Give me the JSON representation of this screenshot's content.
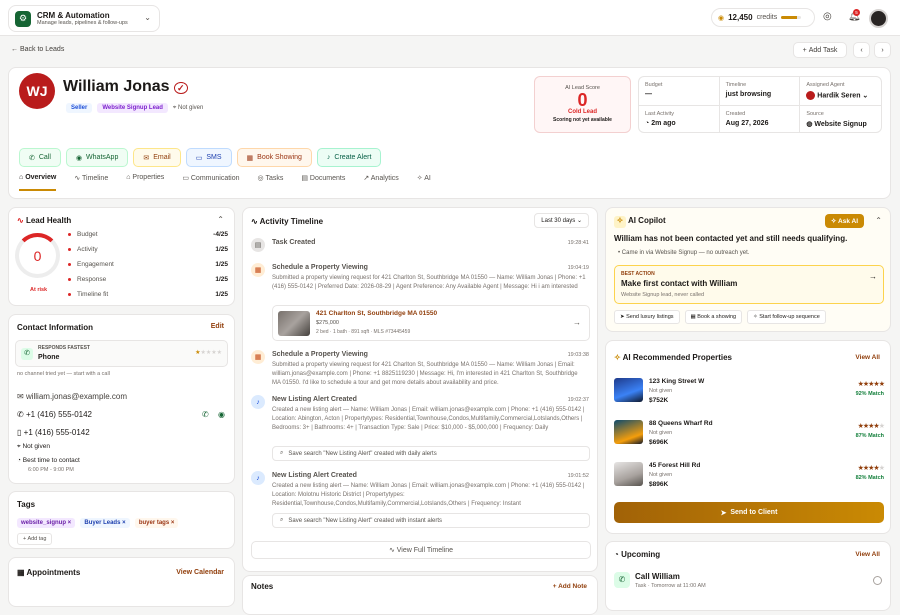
{
  "topbar": {
    "app_title": "CRM & Automation",
    "app_subtitle": "Manage leads, pipelines & follow-ups",
    "credits_value": "12,450",
    "credits_label": "credits",
    "credits_fraction": 0.8,
    "notif_count": "5"
  },
  "nav": {
    "back_label": "Back to Leads",
    "add_task_label": "Add Task"
  },
  "lead": {
    "initials": "WJ",
    "name": "William Jonas",
    "tag_seller": "Seller",
    "tag_source": "Website Signup Lead",
    "not_given": "Not given"
  },
  "score": {
    "label": "AI Lead Score",
    "value": "0",
    "category": "Cold Lead",
    "note": "Scoring not yet available"
  },
  "info": [
    {
      "key": "Budget",
      "value": "—"
    },
    {
      "key": "Timeline",
      "value": "just browsing"
    },
    {
      "key": "Assigned Agent",
      "value": "Hardik Seren"
    },
    {
      "key": "Last Activity",
      "value": "2m ago"
    },
    {
      "key": "Created",
      "value": "Aug 27, 2026"
    },
    {
      "key": "Source",
      "value": "Website Signup"
    }
  ],
  "actions": [
    "Call",
    "WhatsApp",
    "Email",
    "SMS",
    "Book Showing",
    "Create Alert"
  ],
  "tabs": [
    "Overview",
    "Timeline",
    "Properties",
    "Communication",
    "Tasks",
    "Documents",
    "Analytics",
    "AI"
  ],
  "health": {
    "title": "Lead Health",
    "score": "0",
    "risk": "At risk",
    "rows": [
      {
        "label": "Budget",
        "value": "-4/25"
      },
      {
        "label": "Activity",
        "value": "1/25"
      },
      {
        "label": "Engagement",
        "value": "1/25"
      },
      {
        "label": "Response",
        "value": "1/25"
      },
      {
        "label": "Timeline fit",
        "value": "1/25"
      }
    ]
  },
  "contact": {
    "title": "Contact Information",
    "edit": "Edit",
    "responds_label": "RESPONDS FASTEST",
    "channel": "Phone",
    "hint": "no channel tried yet — start with a call",
    "email": "william.jonas@example.com",
    "phone1": "+1 (416) 555-0142",
    "phone2": "+1 (416) 555-0142",
    "address": "Not given",
    "best_time_label": "Best time to contact",
    "best_time": "6:00 PM - 9:00 PM"
  },
  "tags": {
    "title": "Tags",
    "items": [
      "website_signup",
      "Buyer Leads",
      "buyer tags"
    ],
    "add": "Add tag"
  },
  "appointments": {
    "title": "Appointments",
    "link": "View Calendar"
  },
  "timeline": {
    "title": "Activity Timeline",
    "range": "Last 30 days",
    "footer": "View Full Timeline",
    "items": [
      {
        "title": "Task Created",
        "time": "19:28:41",
        "body": ""
      },
      {
        "title": "Schedule a Property Viewing",
        "time": "19:04:19",
        "body": "Submitted a property viewing request for 421 Charlton St, Southbridge MA 01550 — Name: William Jonas | Phone: +1 (416) 555-0142 | Preferred Date: 2026-08-29 | Agent Preference: Any Available Agent | Message: Hi i am interested"
      },
      {
        "title": "Schedule a Property Viewing",
        "time": "19:03:38",
        "body": "Submitted a property viewing request for 421 Charlton St, Southbridge MA 01550 — Name: William Jonas | Email: william.jonas@example.com | Phone: +1 8825119230 | Message: Hi, I'm interested in 421 Charlton St, Southbridge MA 01550. I'd like to schedule a tour and get more details about availability and price."
      },
      {
        "title": "New Listing Alert Created",
        "time": "19:02:37",
        "body": "Created a new listing alert — Name: William Jonas | Email: william.jonas@example.com | Phone: +1 (416) 555-0142 | Location: Abington, Acton | Propertytypes: Residential,Townhouse,Condos,Multifamily,Commercial,Lotslands,Others | Bedrooms: 3+ | Bathrooms: 4+ | Transaction Type: Sale | Price: $10,000 - $5,000,000 | Frequency: Daily"
      },
      {
        "title": "New Listing Alert Created",
        "time": "19:01:52",
        "body": "Created a new listing alert — Name: William Jonas | Email: william.jonas@example.com | Phone: +1 (416) 555-0142 | Location: Molotnu Historic District | Propertytypes: Residential,Townhouse,Condos,Multifamily,Commercial,Lotslands,Others | Frequency: Instant"
      }
    ],
    "property_card": {
      "address": "421 Charlton St, Southbridge MA 01550",
      "price": "$275,000",
      "meta": "2 bed · 1 bath · 891 sqft · MLS #73445459"
    },
    "saved1": "Save search \"New Listing Alert\" created with daily alerts",
    "saved2": "Save search \"New Listing Alert\" created with instant alerts"
  },
  "notes": {
    "title": "Notes",
    "add": "+ Add Note"
  },
  "ai": {
    "title": "AI Copilot",
    "ask": "Ask AI",
    "headline": "William has not been contacted yet and still needs qualifying.",
    "bullet": "Came in via Website Signup — no outreach yet.",
    "best_label": "BEST ACTION",
    "best_title": "Make first contact with William",
    "best_sub": "Website Signup lead, never called",
    "chips": [
      "Send luxury listings",
      "Book a showing",
      "Start follow-up sequence"
    ]
  },
  "recs": {
    "title": "AI Recommended Properties",
    "view_all": "View All",
    "send": "Send to Client",
    "items": [
      {
        "addr": "123 King Street W",
        "sub": "Not given",
        "price": "$752K",
        "match": "92% Match",
        "stars": 5
      },
      {
        "addr": "88 Queens Wharf Rd",
        "sub": "Not given",
        "price": "$696K",
        "match": "87% Match",
        "stars": 4
      },
      {
        "addr": "45 Forest Hill Rd",
        "sub": "Not given",
        "price": "$896K",
        "match": "82% Match",
        "stars": 4
      }
    ]
  },
  "upcoming": {
    "title": "Upcoming",
    "view_all": "View All",
    "task": "Call William",
    "sub": "Task · Tomorrow at 11:00 AM"
  }
}
